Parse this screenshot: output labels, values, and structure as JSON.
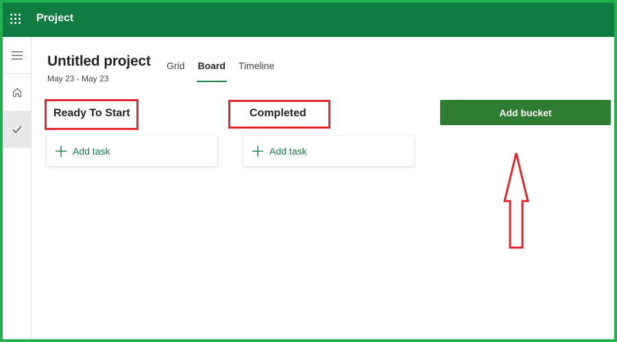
{
  "app": {
    "title": "Project"
  },
  "project": {
    "title": "Untitled project",
    "dates": "May 23 - May 23"
  },
  "tabs": [
    {
      "label": "Grid",
      "active": false
    },
    {
      "label": "Board",
      "active": true
    },
    {
      "label": "Timeline",
      "active": false
    }
  ],
  "buckets": [
    {
      "title": "Ready To Start",
      "add_task_label": "Add task"
    },
    {
      "title": "Completed",
      "add_task_label": "Add task"
    }
  ],
  "add_bucket": {
    "label": "Add bucket"
  },
  "left_rail": {
    "icons": [
      "hamburger-menu-icon",
      "home-icon",
      "checkmark-icon"
    ],
    "active_icon": "checkmark-icon"
  },
  "colors": {
    "brand": "#107c41",
    "add_bucket_button": "#2e7d32",
    "annotation": "#e3242b",
    "screenshot_border": "#22b14c"
  }
}
